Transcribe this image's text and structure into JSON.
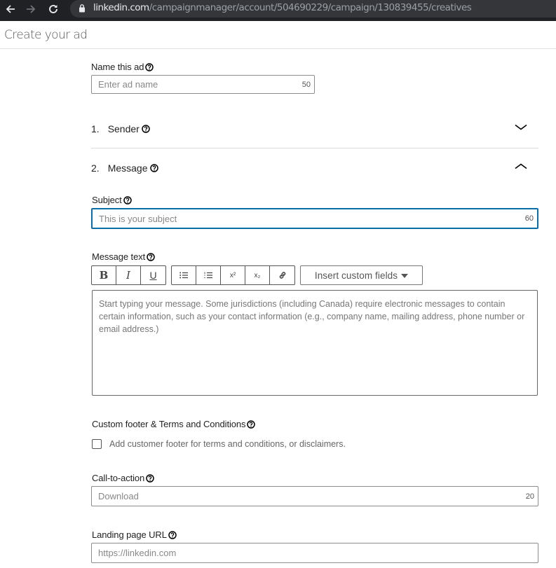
{
  "browser": {
    "url_host": "linkedin.com",
    "url_path": "/campaignmanager/account/504690229/campaign/130839455/creatives"
  },
  "header": {
    "title": "Create your ad"
  },
  "form": {
    "ad_name": {
      "label": "Name this ad",
      "placeholder": "Enter ad name",
      "value": "",
      "char_limit": "50"
    },
    "sections": [
      {
        "number": "1.",
        "title": "Sender",
        "expanded": false
      },
      {
        "number": "2.",
        "title": "Message",
        "expanded": true
      }
    ],
    "subject": {
      "label": "Subject",
      "placeholder": "This is your subject",
      "value": "",
      "char_limit": "60"
    },
    "message_text": {
      "label": "Message text",
      "toolbar": {
        "format_buttons": [
          {
            "name": "bold",
            "glyph": "B"
          },
          {
            "name": "italic",
            "glyph": "I"
          },
          {
            "name": "underline",
            "glyph": "U"
          }
        ],
        "insert_buttons": [
          {
            "name": "bulleted-list"
          },
          {
            "name": "numbered-list"
          },
          {
            "name": "superscript",
            "glyph": "x²"
          },
          {
            "name": "subscript",
            "glyph": "x₂"
          },
          {
            "name": "link"
          }
        ],
        "insert_custom_fields_label": "Insert custom fields"
      },
      "placeholder": "Start typing your message. Some jurisdictions (including Canada) require electronic messages to contain certain information, such as your contact information (e.g., company name, mailing address, phone number or email address.)",
      "value": ""
    },
    "custom_footer": {
      "label": "Custom footer & Terms and Conditions",
      "checkbox_label": "Add customer footer for terms and conditions, or disclaimers.",
      "checked": false
    },
    "call_to_action": {
      "label": "Call-to-action",
      "placeholder": "Download",
      "value": "",
      "char_limit": "20"
    },
    "landing_page_url": {
      "label": "Landing page URL",
      "placeholder": "https://linkedin.com",
      "value": ""
    }
  },
  "colors": {
    "focus_border": "#0a6ea8",
    "chrome_bg": "#202124"
  }
}
